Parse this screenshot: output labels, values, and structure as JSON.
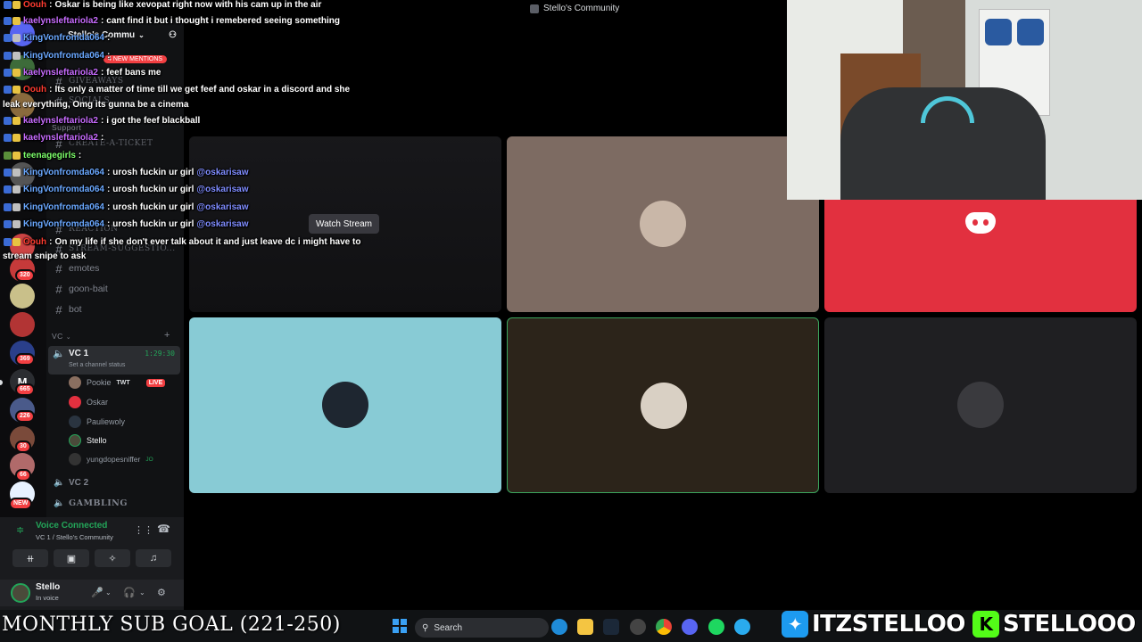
{
  "window": {
    "title": "Stello's Community"
  },
  "server": {
    "name": "Stello's Commu",
    "new_mentions": "4 NEW MENTIONS"
  },
  "server_rail": {
    "badges": [
      "320",
      "369",
      "665",
      "226",
      "30",
      "66",
      "NEW"
    ]
  },
  "channels": {
    "giveaways": "GIVEAWAYS",
    "socials": "SOCIALS",
    "support": "Support",
    "create_ticket": "CREATE-A-TICKET",
    "reaction": "REACTION",
    "stream_suggestions": "STREAM-SUGGESTIO...",
    "emotes": "emotes",
    "goon_bait": "goon-bait",
    "bot": "bot",
    "vc_category": "VC",
    "vc1": {
      "name": "VC 1",
      "timer": "1:29:30",
      "status": "Set a channel status"
    },
    "vc2": "VC 2",
    "gambling": "GAMBLING"
  },
  "vc_members": [
    {
      "name": "Pookie",
      "tag": "TWT",
      "live": "LIVE"
    },
    {
      "name": "Oskar"
    },
    {
      "name": "Pauliewoly"
    },
    {
      "name": "Stello"
    },
    {
      "name": "yungdopesniffer",
      "tag": "JO"
    }
  ],
  "voice_panel": {
    "status": "Voice Connected",
    "channel": "VC 1 / Stello's Community"
  },
  "user_panel": {
    "name": "Stello",
    "status": "In voice"
  },
  "stream": {
    "watch_label": "Watch Stream"
  },
  "chat": [
    {
      "user": "Oouh",
      "color": "#ff3b30",
      "text": "Oskar is being like xevopat right now with his cam up in the air"
    },
    {
      "user": "kaelynsleftariola2",
      "color": "#c86cff",
      "text": "cant find it but i thought i remebered seeing something"
    },
    {
      "user": "KingVonfromda064",
      "color": "#6aa8ff",
      "text": ""
    },
    {
      "user": "KingVonfromda064",
      "color": "#6aa8ff",
      "text": ""
    },
    {
      "user": "kaelynsleftariola2",
      "color": "#c86cff",
      "text": "feef bans me"
    },
    {
      "user": "Oouh",
      "color": "#ff3b30",
      "text": "Its only a matter of time till we get feef and oskar in a discord and she"
    },
    {
      "user": "kaelynsleftariola2",
      "color": "#c86cff",
      "text": "i got the feef blackball"
    },
    {
      "user": "kaelynsleftariola2",
      "color": "#c86cff",
      "text": ""
    },
    {
      "user": "teenagegirls",
      "color": "#7dff6b",
      "text": ""
    },
    {
      "user": "KingVonfromda064",
      "color": "#6aa8ff",
      "text": "urosh fuckin ur girl",
      "mention": "@oskarisaw"
    },
    {
      "user": "KingVonfromda064",
      "color": "#6aa8ff",
      "text": "urosh fuckin ur girl",
      "mention": "@oskarisaw"
    },
    {
      "user": "KingVonfromda064",
      "color": "#6aa8ff",
      "text": "urosh fuckin ur girl",
      "mention": "@oskarisaw"
    },
    {
      "user": "KingVonfromda064",
      "color": "#6aa8ff",
      "text": "urosh fuckin ur girl",
      "mention": "@oskarisaw"
    },
    {
      "user": "Oouh",
      "color": "#ff3b30",
      "text": "On my life if she don't ever talk about it and just leave dc i might have to"
    }
  ],
  "chat_wraps": {
    "line1": "leak everything, Omg its gunna be a cinema",
    "line2": "stream snipe to ask"
  },
  "bottom": {
    "sub_goal": "MONTHLY SUB GOAL (221-250)",
    "search": "Search",
    "twitter": "ITZSTELLOO",
    "kick": "STELLOOO"
  },
  "colors": {
    "accent_green": "#23a559",
    "live_red": "#f23f42",
    "discord_tile": "#e2303f",
    "tile_cyan": "#88cbd5",
    "tile_taupe": "#7d6b62",
    "tile_brown": "#2c241a",
    "tile_dark": "#1f1f22"
  },
  "icons": {
    "discord": "discord-icon",
    "speaker": "speaker-icon",
    "hash": "hash-icon",
    "search": "search-icon",
    "windows": "windows-start-icon"
  }
}
